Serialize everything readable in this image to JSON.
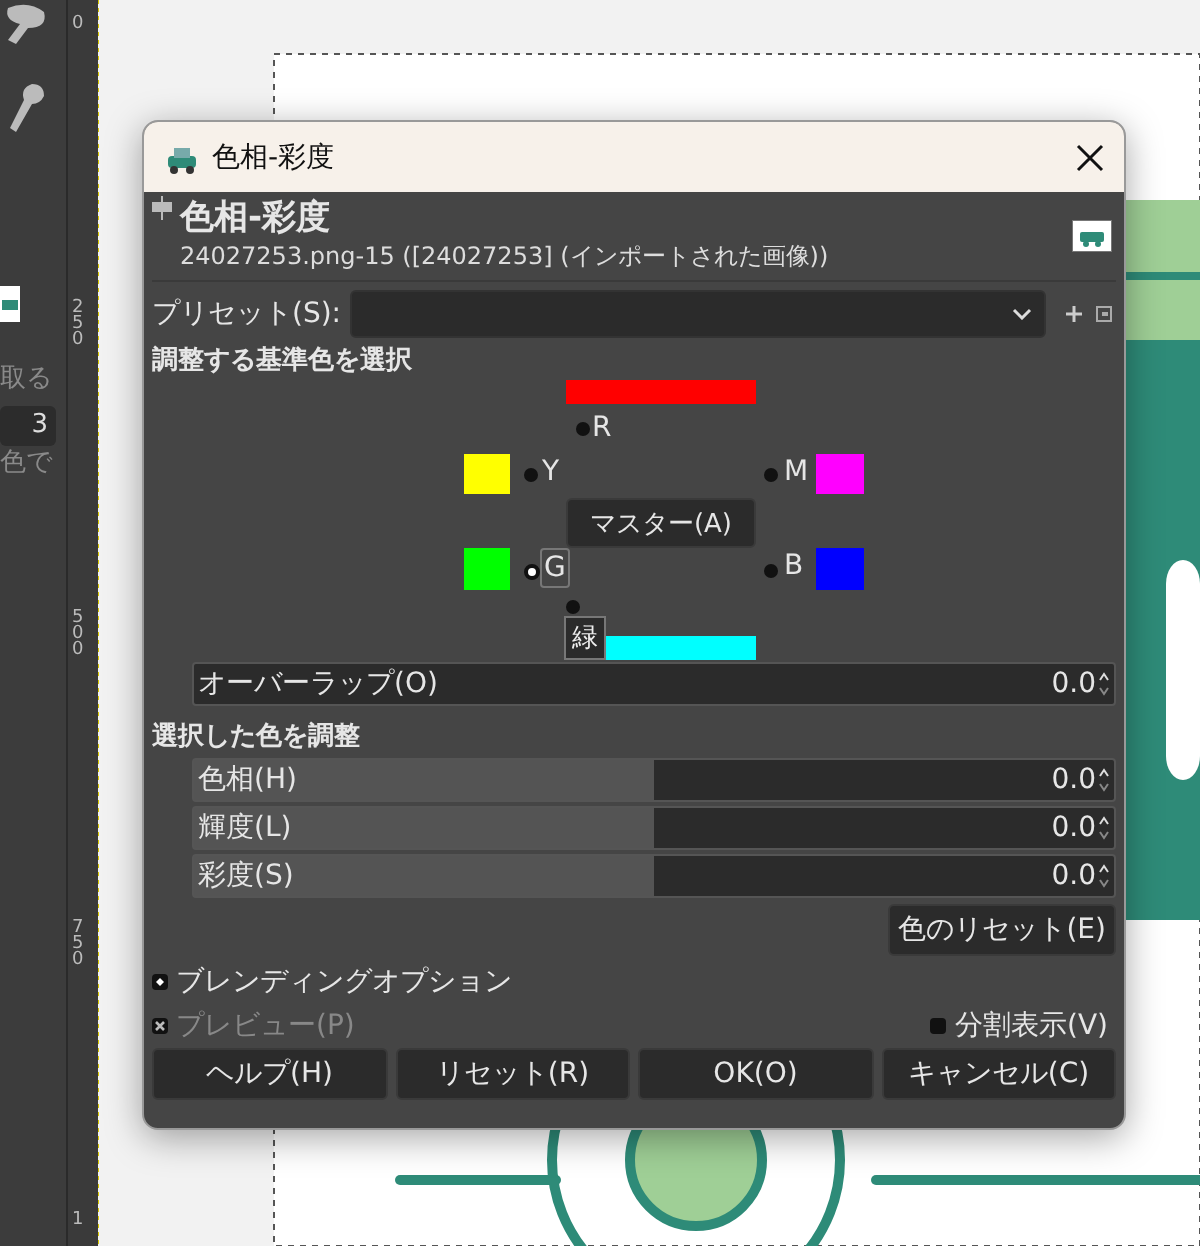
{
  "background": {
    "sidebar_texts": [
      "取る",
      "3",
      "色で"
    ],
    "ruler_labels": [
      "0",
      "250",
      "500",
      "750",
      "1"
    ]
  },
  "dialog": {
    "title": "色相-彩度",
    "header": {
      "title": "色相-彩度",
      "subtitle": "24027253.png-15 ([24027253] (インポートされた画像))"
    },
    "preset": {
      "label": "プリセット(S):"
    },
    "color_select": {
      "heading": "調整する基準色を選択",
      "master": "マスター(A)",
      "tooltip": "緑",
      "colors": [
        {
          "label": "R",
          "color": "#ff0000",
          "selected": false
        },
        {
          "label": "Y",
          "color": "#ffff00",
          "selected": false
        },
        {
          "label": "M",
          "color": "#ff00ff",
          "selected": false
        },
        {
          "label": "G",
          "color": "#00ff00",
          "selected": true
        },
        {
          "label": "B",
          "color": "#0000ff",
          "selected": false
        },
        {
          "color": "#00ffff",
          "selected": false
        }
      ]
    },
    "overlap": {
      "label": "オーバーラップ(O)",
      "value": "0.0",
      "level": 0
    },
    "adjust": {
      "heading": "選択した色を調整",
      "sliders": [
        {
          "label": "色相(H)",
          "value": "0.0",
          "level": 0.5
        },
        {
          "label": "輝度(L)",
          "value": "0.0",
          "level": 0.5
        },
        {
          "label": "彩度(S)",
          "value": "0.0",
          "level": 0.5
        }
      ]
    },
    "reset_color": "色のリセット(E)",
    "blending": {
      "label": "ブレンディングオプション",
      "expanded": false
    },
    "preview": {
      "label": "プレビュー(P)",
      "checked": true,
      "disabled": true
    },
    "split_view": {
      "label": "分割表示(V)",
      "checked": false
    },
    "buttons": [
      "ヘルプ(H)",
      "リセット(R)",
      "OK(O)",
      "キャンセル(C)"
    ]
  }
}
